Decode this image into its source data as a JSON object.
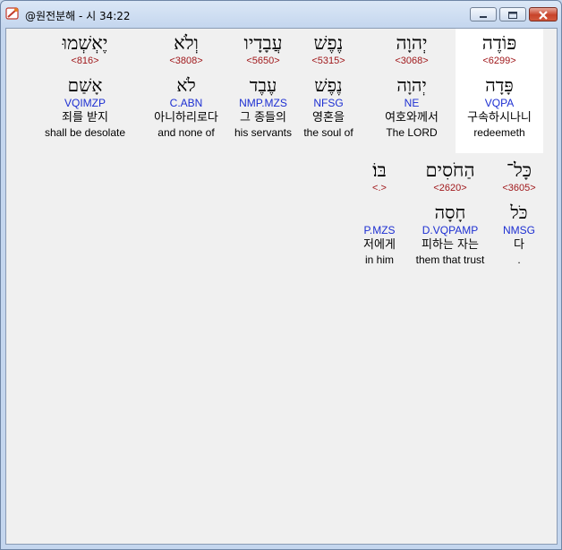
{
  "window": {
    "title": "@원전분해 - 시 34:22"
  },
  "row1": [
    {
      "hebrew": "פּוֹדֶה",
      "strong": "<6299>",
      "lemma": "פָּדָה",
      "morph": "VQPA",
      "korean": "구속하시나니",
      "english": "redeemeth"
    },
    {
      "hebrew": "יְהוָה",
      "strong": "<3068>",
      "lemma": "יְהוָה",
      "morph": "NE",
      "korean": "여호와께서",
      "english": "The LORD"
    },
    {
      "hebrew": "נֶפֶשׁ",
      "strong": "<5315>",
      "lemma": "נֶפֶשׁ",
      "morph": "NFSG",
      "korean": "영혼을",
      "english": "the soul of"
    },
    {
      "hebrew": "עֲבָדָיו",
      "strong": "<5650>",
      "lemma": "עֶבֶד",
      "morph": "NMP.MZS",
      "korean": "그 종들의",
      "english": "his servants"
    },
    {
      "hebrew": "וְלֹא",
      "strong": "<3808>",
      "lemma": "לֹא",
      "morph": "C.ABN",
      "korean": "아니하리로다",
      "english": "and none of"
    },
    {
      "hebrew": "יֶאְשְׁמוּ",
      "strong": "<816>",
      "lemma": "אָשַׁם",
      "morph": "VQIMZP",
      "korean": "죄를 받지",
      "english": "shall be desolate"
    }
  ],
  "row2": [
    {
      "hebrew": "כָּל־",
      "strong": "<3605>",
      "lemma": "כֹּל",
      "morph": "NMSG",
      "korean": "다",
      "english": "."
    },
    {
      "hebrew": "הַחֹסִים",
      "strong": "<2620>",
      "lemma": "חָסָה",
      "morph": "D.VQPAMP",
      "korean": "피하는 자는",
      "english": "them that trust"
    },
    {
      "hebrew": "בּוֹ׃",
      "strong": "<.>",
      "lemma": "",
      "morph": "P.MZS",
      "korean": "저에게",
      "english": "in him"
    }
  ]
}
